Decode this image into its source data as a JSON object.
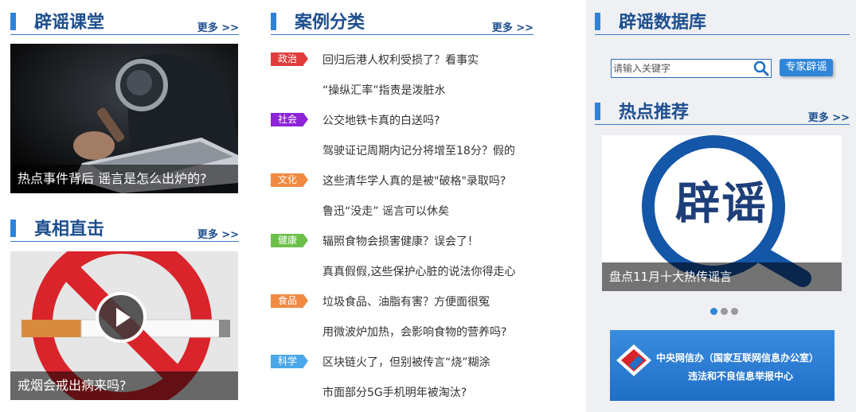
{
  "sections": {
    "rumor_class": {
      "title": "辟谣课堂",
      "more": "更多 >>",
      "caption": "热点事件背后 谣言是怎么出炉的?"
    },
    "truth": {
      "title": "真相直击",
      "more": "更多 >>",
      "caption": "戒烟会戒出病来吗?"
    },
    "cases": {
      "title": "案例分类",
      "more": "更多 >>"
    },
    "database": {
      "title": "辟谣数据库",
      "search_placeholder": "请输入关键字",
      "expert_button": "专家辟谣"
    },
    "hot": {
      "title": "热点推荐",
      "more": "更多 >>",
      "caption": "盘点11月十大热传谣言",
      "logo_text": "辟谣"
    }
  },
  "case_rows": [
    {
      "tag": "政治",
      "text": "回归后港人权利受损了？看事实"
    },
    {
      "tag": "",
      "text": "“操纵汇率”指责是泼脏水"
    },
    {
      "tag": "社会",
      "text": "公交地铁卡真的白送吗?"
    },
    {
      "tag": "",
      "text": "驾驶证记周期内记分将增至18分？假的"
    },
    {
      "tag": "文化",
      "text": "这些清华学人真的是被\"破格\"录取吗?"
    },
    {
      "tag": "",
      "text": "鲁迅“没走” 谣言可以休矣"
    },
    {
      "tag": "健康",
      "text": "辐照食物会损害健康？误会了！"
    },
    {
      "tag": "",
      "text": "真真假假,这些保护心脏的说法你得走心"
    },
    {
      "tag": "食品",
      "text": "垃圾食品、油脂有害？方便面很冤"
    },
    {
      "tag": "",
      "text": "用微波炉加热，会影响食物的营养吗?"
    },
    {
      "tag": "科学",
      "text": "区块链火了，但别被传言“烧”糊涂"
    },
    {
      "tag": "",
      "text": "市面部分5G手机明年被淘汰?"
    }
  ],
  "tag_colors": {
    "政治": "#e03c3c",
    "社会": "#8e24d8",
    "文化": "#f08a42",
    "健康": "#6cc04a",
    "食品": "#f08a42",
    "科学": "#4aa8e8"
  },
  "carousel": {
    "dots": 3,
    "active_index": 0
  },
  "banner": {
    "line1": "中央网信办（国家互联网信息办公室）",
    "line2": "违法和不良信息举报中心"
  }
}
